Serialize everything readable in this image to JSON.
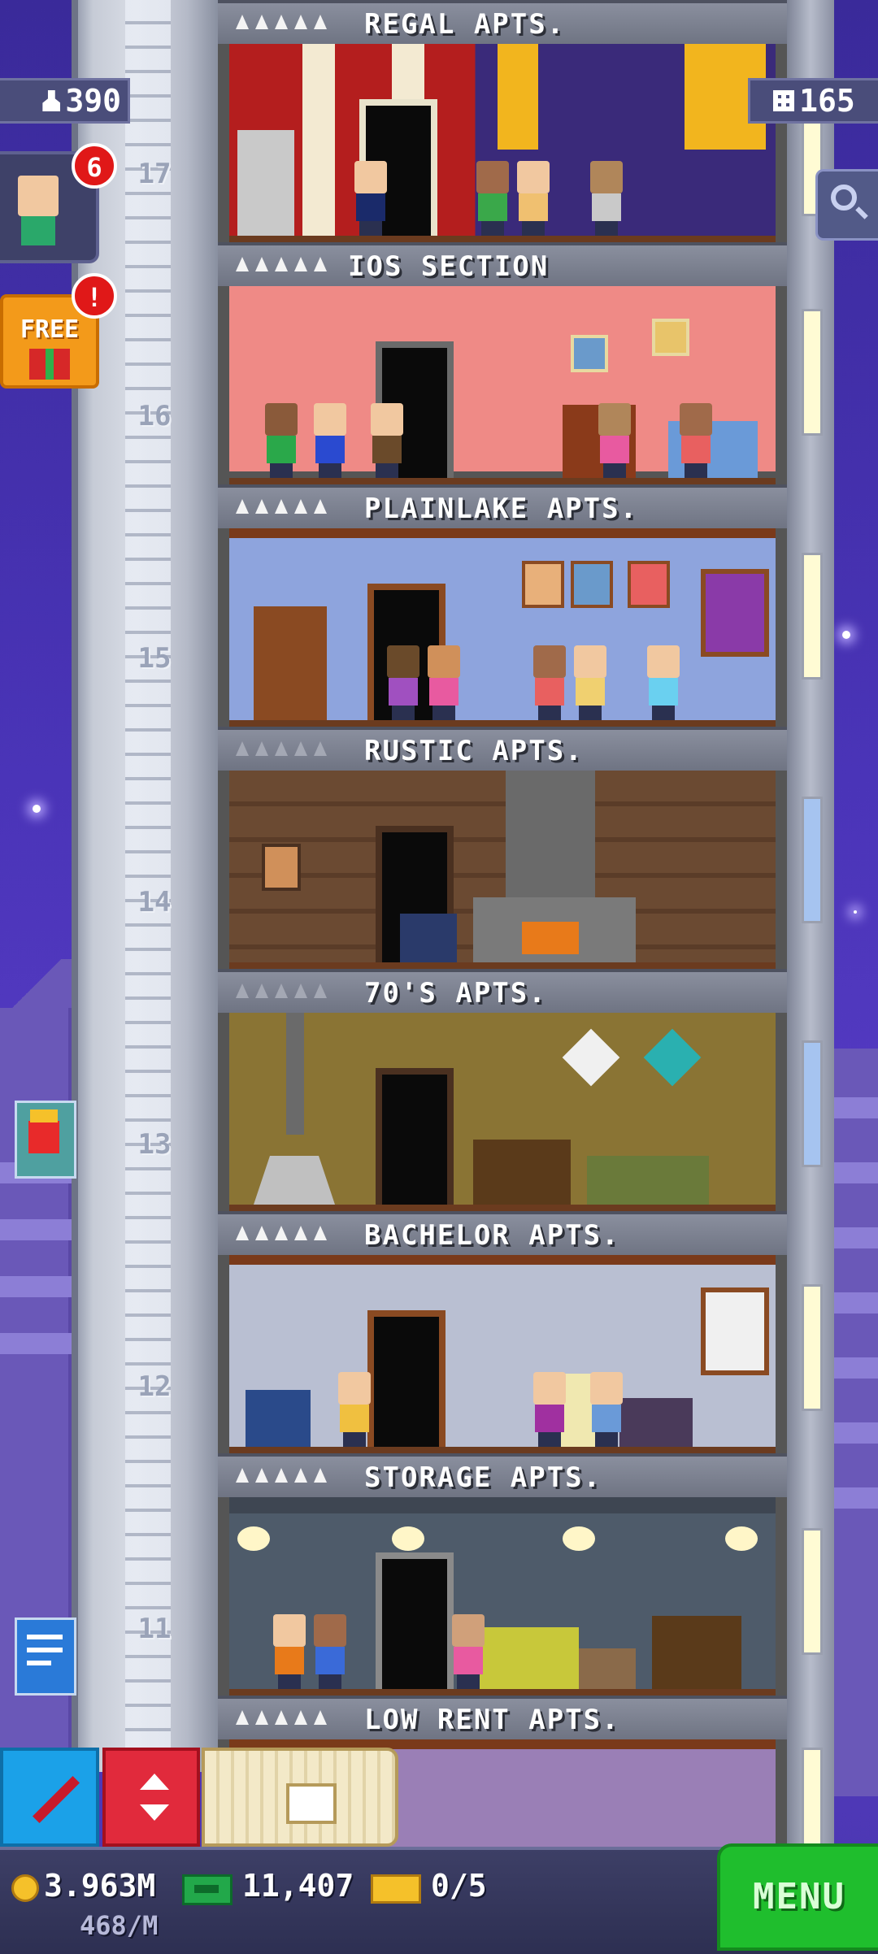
{
  "hud": {
    "population": "390",
    "floors": "165",
    "bitizen_notifications": "6",
    "free_badge": "!",
    "free_label": "FREE"
  },
  "floors": [
    {
      "number": "17",
      "name": "REGAL APTS.",
      "color": "#9e1b1b",
      "stars_dim": false
    },
    {
      "number": "16",
      "name": "IOS SECTION",
      "color": "#ef8a86",
      "stars_dim": false
    },
    {
      "number": "15",
      "name": "PLAINLAKE APTS.",
      "color": "#8ea4dd",
      "stars_dim": false
    },
    {
      "number": "14",
      "name": "RUSTIC APTS.",
      "color": "#6b4a32",
      "stars_dim": true
    },
    {
      "number": "13",
      "name": "70'S APTS.",
      "color": "#8a7434",
      "stars_dim": true
    },
    {
      "number": "12",
      "name": "BACHELOR APTS.",
      "color": "#b9bfd2",
      "stars_dim": false
    },
    {
      "number": "11",
      "name": "STORAGE APTS.",
      "color": "#4e5b6a",
      "stars_dim": false
    },
    {
      "number": "",
      "name": "LOW RENT APTS.",
      "color": "#9a7fb6",
      "stars_dim": false
    }
  ],
  "status": {
    "coins": "3.963M",
    "coin_rate": "468/M",
    "bux": "11,407",
    "tickets": "0/5"
  },
  "menu_label": "MENU",
  "icons": [
    "person-icon",
    "grid-icon",
    "magnifier-icon",
    "gift-icon",
    "hammer-icon",
    "elevator-arrows-icon",
    "build-floor-icon",
    "coin-icon",
    "cash-icon",
    "ticket-icon"
  ]
}
